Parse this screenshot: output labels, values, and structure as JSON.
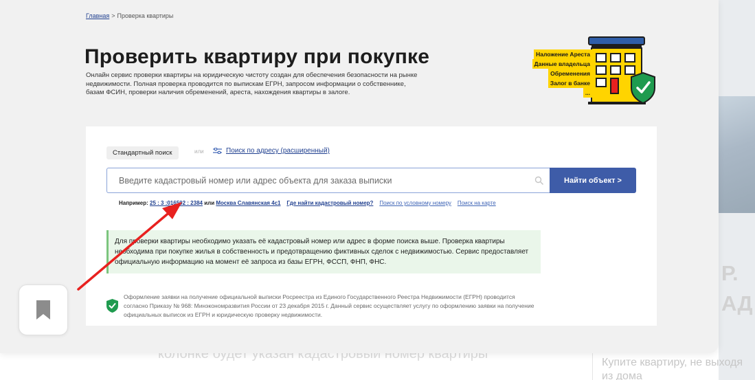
{
  "background_page": {
    "heading_lines": [
      "Р.",
      "АД"
    ],
    "side_lines": [
      "Купите квартиру, не выходя",
      "из дома"
    ],
    "under_text": "колонке будет указан кадастровый номер квартиры"
  },
  "breadcrumb": {
    "home": "Главная",
    "separator": ">",
    "current": "Проверка квартиры"
  },
  "page": {
    "title": "Проверить квартиру при покупке",
    "description": "Онлайн сервис проверки квартиры на юридическую чистоту создан для обеспечения безопасности на рынке недвижимости. Полная проверка проводится по выпискам ЕГРН, запросом информации о собственнике, базам ФСИН, проверки наличия обременений, ареста, нахождения квартиры в залоге."
  },
  "hero": {
    "labels": [
      "Наложение Ареста",
      "Данные владельца",
      "Обременения",
      "Залог в банке",
      "..."
    ],
    "icon": "building-check-icon"
  },
  "search": {
    "standard_tab": "Стандартный поиск",
    "or": "или",
    "advanced_link": "Поиск по адресу (расширенный)",
    "placeholder": "Введите кадастровый номер или адрес объекта для заказа выписки",
    "value": "",
    "button": "Найти объект >"
  },
  "examples": {
    "prefix": "Например:",
    "cadastral": "25 : 3 :016502 : 2384",
    "or": "или",
    "address": "Москва Славянская 4с1",
    "where_link": "Где найти кадастровый номер?",
    "conditional_link": "Поиск по условному номеру",
    "map_link": "Поиск на карте"
  },
  "info": {
    "text": "Для проверки квартиры необходимо указать её кадастровый номер или адрес в форме поиска выше. Проверка квартиры необходима при покупке жилья в собственность и предотвращению фиктивных сделок с недвижимостью. Сервис предоставляет официальную информацию на момент её запроса из базы ЕГРН, ФССП, ФНП, ФНС."
  },
  "legal": {
    "text": "Оформление заявки на получение официальной выписки Росреестра из Единого Государственного Реестра Недвижимости (ЕГРН) проводится согласно Приказу № 968: Минэкономразвития России от 23 декабря 2015 г. Данный сервис осуществляет услугу по оформлению заявки на получение официальных выписок из ЕГРН и юридическую проверку недвижимости."
  },
  "colors": {
    "accent": "#3e5ca8",
    "link": "#1f3f8f",
    "arrow": "#e8211f",
    "highlight": "#ffd400",
    "shield": "#1f9b4f"
  }
}
